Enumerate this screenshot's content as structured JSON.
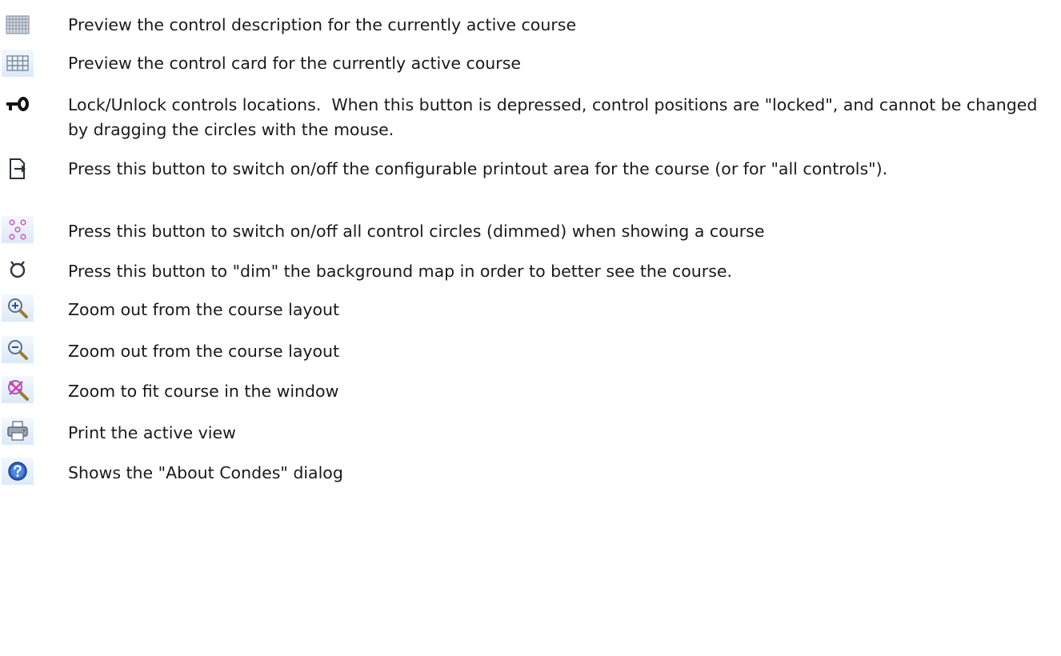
{
  "items": [
    {
      "icon": "control-description-icon",
      "text": "Preview the control description for the currently active course"
    },
    {
      "icon": "control-card-icon",
      "text": "Preview the control card for the currently active course"
    },
    {
      "icon": "lock-key-icon",
      "text": "Lock/Unlock controls locations.  When this button is depressed, control positions are \"locked\", and cannot be changed by dragging the circles with the mouse."
    },
    {
      "icon": "printout-area-icon",
      "text": "Press this button to switch on/off the configurable printout area for the course (or for \"all controls\")."
    },
    {
      "icon": "control-circles-icon",
      "text": "Press this button to switch on/off all control circles (dimmed) when showing a course"
    },
    {
      "icon": "dim-map-icon",
      "text": "Press this button to \"dim\" the background map in order to better see the course."
    },
    {
      "icon": "zoom-in-icon",
      "text": "Zoom out from the course layout"
    },
    {
      "icon": "zoom-out-icon",
      "text": "Zoom out from the course layout"
    },
    {
      "icon": "zoom-fit-icon",
      "text": "Zoom to fit course in the window"
    },
    {
      "icon": "printer-icon",
      "text": "Print the active view"
    },
    {
      "icon": "help-icon",
      "text": "Shows the \"About Condes\" dialog"
    }
  ]
}
